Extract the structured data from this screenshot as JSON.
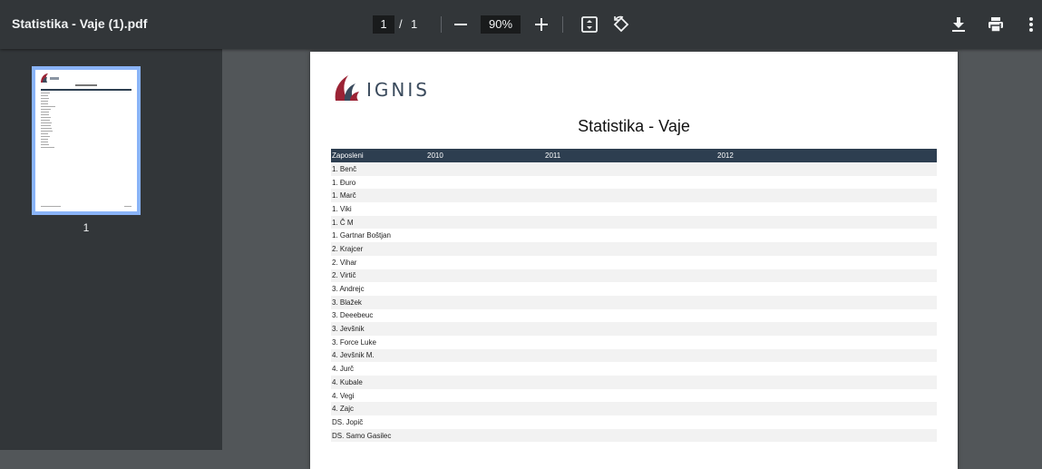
{
  "toolbar": {
    "title": "Statistika - Vaje (1).pdf",
    "page_current": "1",
    "page_separator": "/",
    "page_total": "1",
    "zoom": "90%"
  },
  "sidebar": {
    "thumbnail_label": "1"
  },
  "document": {
    "logo_text": "IGNIS",
    "title": "Statistika - Vaje",
    "table": {
      "headers": [
        "Zaposleni",
        "2010",
        "2011",
        "2012"
      ],
      "rows": [
        "1.  Benč",
        "1.  Đuro",
        "1.  Marč",
        "1.  Viki",
        "1. Č M",
        "1. Gartnar Boštjan",
        "2.  Krajcer",
        "2.  Vihar",
        "2.  Virtič",
        "3.  Andrejc",
        "3.  Blažek",
        "3.  Deeebeuc",
        "3.  Jevšnik",
        "3. Force Luke",
        "4.  Jevšnik M.",
        "4.  Jurč",
        "4.  Kubale",
        "4.  Vegi",
        "4.  Zajc",
        "DS.  Jopič",
        "DS. Samo Gasilec"
      ]
    }
  }
}
